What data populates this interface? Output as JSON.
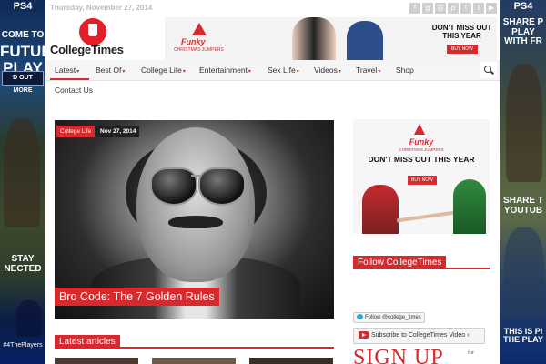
{
  "left_skin": {
    "logo": "PS4",
    "tagline": "COME TO",
    "headline": "FUTURE PLAY",
    "more": "D OUT MORE",
    "bottom": "STAY NECTED",
    "hashtag": "#4ThePlayers"
  },
  "right_skin": {
    "logo": "PS4",
    "tagline": "SHARE P PLAY WITH FR",
    "share2": "SHARE T YOUTUB",
    "share3": "THIS IS PI THE PLAY"
  },
  "header": {
    "date": "Thursday, November 27, 2014",
    "logo_text": "CollegeTimes",
    "social_icons": [
      "facebook-icon",
      "google-plus-icon",
      "instagram-icon",
      "pinterest-icon",
      "tumblr-icon",
      "twitter-icon",
      "youtube-icon"
    ],
    "social_glyphs": [
      "f",
      "g",
      "◎",
      "p",
      "t",
      "t",
      "▶"
    ]
  },
  "top_ad": {
    "brand": "Funky",
    "brand_sub": "CHRISTMAS JUMPERS",
    "title": "DON'T MISS OUT THIS YEAR",
    "button": "BUY NOW"
  },
  "nav": {
    "items": [
      {
        "label": "Latest",
        "caret": "▾"
      },
      {
        "label": "Best Of",
        "caret": "▾"
      },
      {
        "label": "College Life",
        "caret": "▾"
      },
      {
        "label": "Entertainment",
        "caret": "▾"
      },
      {
        "label": "Sex Life",
        "caret": "▾"
      },
      {
        "label": "Videos",
        "caret": "▾"
      },
      {
        "label": "Travel",
        "caret": "▾"
      },
      {
        "label": "Shop",
        "caret": ""
      }
    ],
    "second_row": "Contact Us"
  },
  "hero": {
    "category": "College Life",
    "date": "Nov 27, 2014",
    "title": "Bro Code: The 7 Golden Rules"
  },
  "latest": {
    "heading": "Latest articles"
  },
  "side_ad": {
    "brand": "Funky",
    "brand_sub": "CHRISTMAS JUMPERS",
    "title": "DON'T MISS OUT THIS YEAR",
    "button": "BUY NOW"
  },
  "sidebar": {
    "follow_heading": "Follow CollegeTimes",
    "twitter_button": "Follow @college_times",
    "youtube_button": "Subscribe to CollegeTimes Video",
    "youtube_caret": "›",
    "signup": "SIGN UP",
    "signup_small": "for"
  }
}
